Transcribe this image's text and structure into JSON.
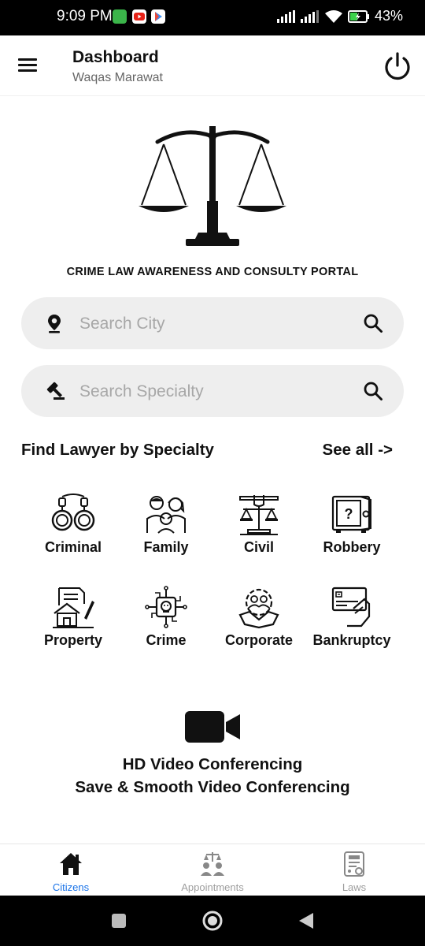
{
  "status_bar": {
    "time": "9:09 PM",
    "battery": "43%"
  },
  "header": {
    "title": "Dashboard",
    "subtitle": "Waqas Marawat"
  },
  "portal_title": "CRIME LAW AWARENESS AND CONSULTY PORTAL",
  "search_city": {
    "placeholder": "Search City"
  },
  "search_specialty": {
    "placeholder": "Search Specialty"
  },
  "specialty": {
    "heading": "Find Lawyer by Specialty",
    "see_all": "See all ->"
  },
  "categories": [
    {
      "label": "Criminal",
      "icon": "handcuffs-icon"
    },
    {
      "label": "Family",
      "icon": "family-icon"
    },
    {
      "label": "Civil",
      "icon": "civil-rights-icon"
    },
    {
      "label": "Robbery",
      "icon": "safe-icon"
    },
    {
      "label": "Property",
      "icon": "property-document-icon"
    },
    {
      "label": "Crime",
      "icon": "cyber-crime-icon"
    },
    {
      "label": "Corporate",
      "icon": "handshake-gear-icon"
    },
    {
      "label": "Bankruptcy",
      "icon": "credit-card-hand-icon"
    }
  ],
  "video": {
    "line1": "HD Video Conferencing",
    "line2": "Save & Smooth Video Conferencing"
  },
  "bottom_nav": [
    {
      "label": "Citizens",
      "active": true
    },
    {
      "label": "Appointments",
      "active": false
    },
    {
      "label": "Laws",
      "active": false
    }
  ],
  "colors": {
    "accent": "#1a73e8",
    "inactive": "#9e9e9e",
    "search_bg": "#eeeeee"
  }
}
